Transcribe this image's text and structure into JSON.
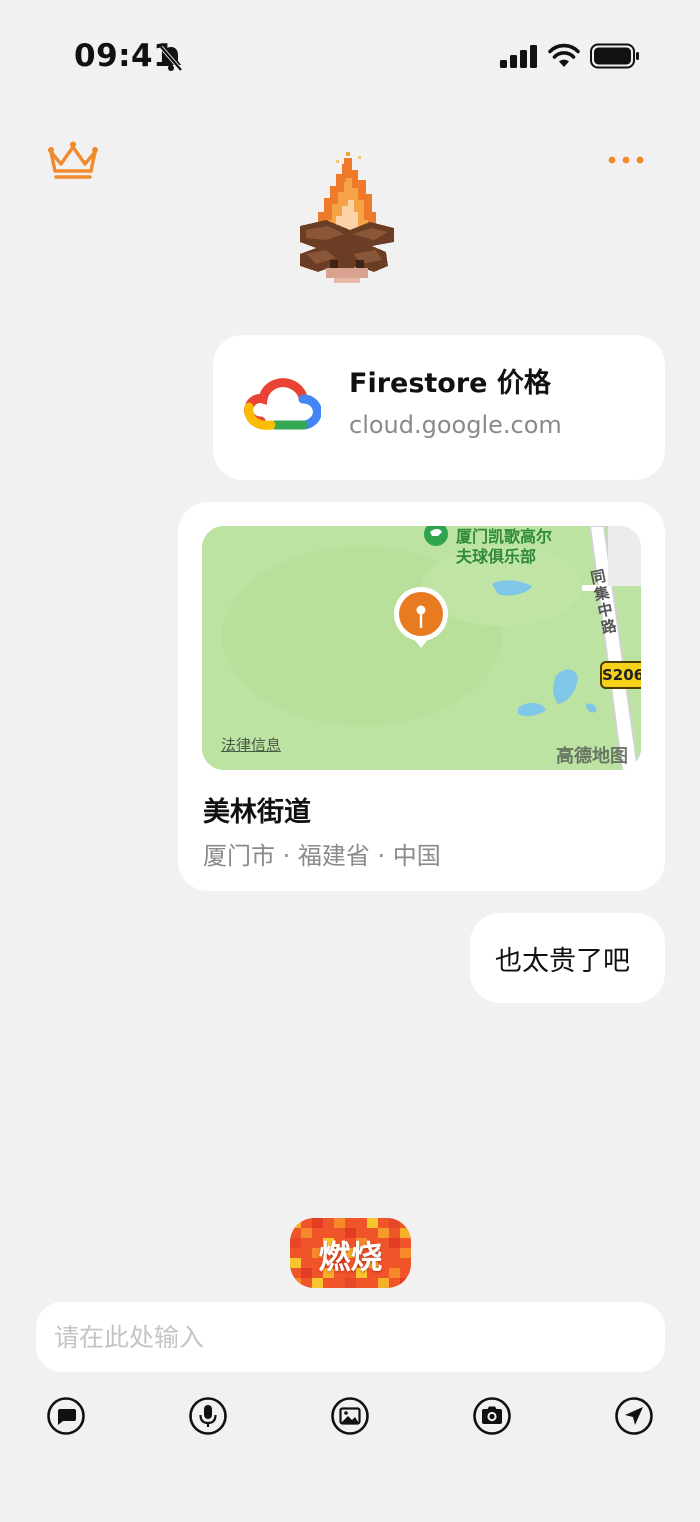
{
  "status_bar": {
    "time": "09:41"
  },
  "header": {
    "crown_icon": "crown-icon",
    "more_icon": "more-dots-icon",
    "avatar": "pixel-campfire"
  },
  "messages": {
    "link_card": {
      "title": "Firestore 价格",
      "domain": "cloud.google.com",
      "icon": "google-cloud-logo"
    },
    "location_card": {
      "map": {
        "legal_link": "法律信息",
        "brand": "高德地图",
        "poi_name_line1": "厦门凯歌高尔",
        "poi_name_line2": "夫球俱乐部",
        "road_name": "同集中路",
        "road_badge": "S206"
      },
      "place_name": "美林街道",
      "address": "厦门市 · 福建省 · 中国"
    },
    "text_message": {
      "text": "也太贵了吧"
    }
  },
  "burn_button": {
    "label": "燃烧"
  },
  "composer": {
    "placeholder": "请在此处输入",
    "value": ""
  },
  "toolbar": {
    "items": [
      "chat-bubble-icon",
      "microphone-icon",
      "image-icon",
      "camera-icon",
      "location-arrow-icon"
    ]
  },
  "colors": {
    "accent": "#f08a2c",
    "background": "#f1f1f1",
    "bubble": "#ffffff",
    "map_green": "#bde3a2"
  }
}
